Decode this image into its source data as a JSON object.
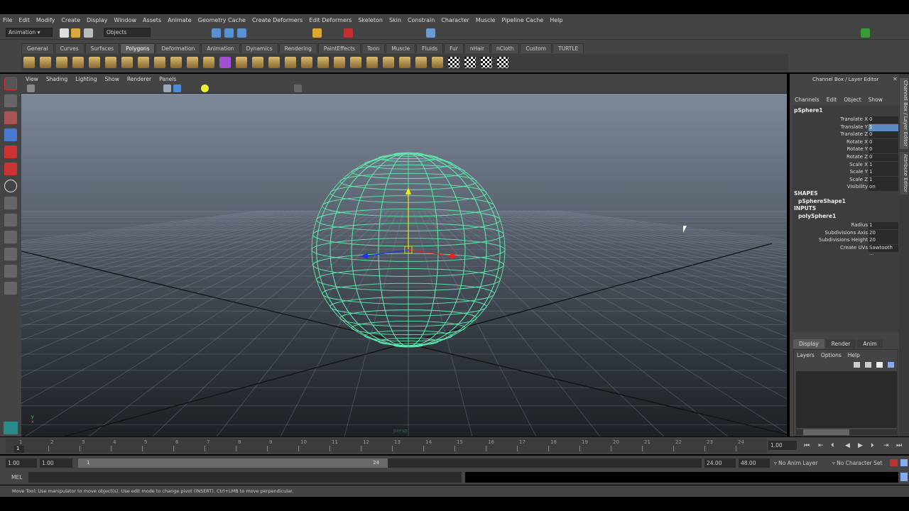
{
  "menu": [
    "File",
    "Edit",
    "Modify",
    "Create",
    "Display",
    "Window",
    "Assets",
    "Animate",
    "Geometry Cache",
    "Create Deformers",
    "Edit Deformers",
    "Skeleton",
    "Skin",
    "Constrain",
    "Character",
    "Muscle",
    "Pipeline Cache",
    "Help"
  ],
  "status": {
    "menu_set": "Animation",
    "selection_mode": "Objects"
  },
  "shelf": {
    "tabs": [
      "General",
      "Curves",
      "Surfaces",
      "Polygons",
      "Deformation",
      "Animation",
      "Dynamics",
      "Rendering",
      "PaintEffects",
      "Toon",
      "Muscle",
      "Fluids",
      "Fur",
      "nHair",
      "nCloth",
      "Custom",
      "TURTLE"
    ],
    "active": "Polygons",
    "icon_count": 30
  },
  "viewport": {
    "menu": [
      "View",
      "Shading",
      "Lighting",
      "Show",
      "Renderer",
      "Panels"
    ],
    "camera_label": "persp",
    "wire_color": "#5fe8b0"
  },
  "channel_box": {
    "title": "Channel Box / Layer Editor",
    "menu": [
      "Channels",
      "Edit",
      "Object",
      "Show"
    ],
    "object": "pSphere1",
    "attrs": [
      {
        "name": "Translate X",
        "value": "0"
      },
      {
        "name": "Translate Y",
        "value": "1"
      },
      {
        "name": "Translate Z",
        "value": "0"
      },
      {
        "name": "Rotate X",
        "value": "0"
      },
      {
        "name": "Rotate Y",
        "value": "0"
      },
      {
        "name": "Rotate Z",
        "value": "0"
      },
      {
        "name": "Scale X",
        "value": "1"
      },
      {
        "name": "Scale Y",
        "value": "1"
      },
      {
        "name": "Scale Z",
        "value": "1"
      },
      {
        "name": "Visibility",
        "value": "on"
      }
    ],
    "shapes_label": "SHAPES",
    "shape": "pSphereShape1",
    "inputs_label": "INPUTS",
    "input": "polySphere1",
    "input_attrs": [
      {
        "name": "Radius",
        "value": "1"
      },
      {
        "name": "Subdivisions Axis",
        "value": "20"
      },
      {
        "name": "Subdivisions Height",
        "value": "20"
      },
      {
        "name": "Create UVs",
        "value": "Sawtooth ..."
      }
    ]
  },
  "side_tabs": [
    "Channel Box / Layer Editor",
    "Attribute Editor"
  ],
  "layer_editor": {
    "tabs": [
      "Display",
      "Render",
      "Anim"
    ],
    "menu": [
      "Layers",
      "Options",
      "Help"
    ]
  },
  "timeline": {
    "ticks": [
      "1",
      "2",
      "3",
      "4",
      "5",
      "6",
      "7",
      "8",
      "9",
      "10",
      "11",
      "12",
      "13",
      "14",
      "15",
      "16",
      "17",
      "18",
      "19",
      "20",
      "21",
      "22",
      "23",
      "24"
    ],
    "current_frame": "1",
    "current_time": "1.00"
  },
  "range": {
    "start": "1.00",
    "playback_start": "1.00",
    "slider_start": "1",
    "slider_end": "24",
    "playback_end": "24.00",
    "end": "48.00",
    "anim_layer": "No Anim Layer",
    "character_set": "No Character Set"
  },
  "mel": {
    "label": "MEL"
  },
  "help_line": "Move Tool: Use manipulator to move object(s). Use edit mode to change pivot (INSERT).  Ctrl+LMB to move perpendicular."
}
